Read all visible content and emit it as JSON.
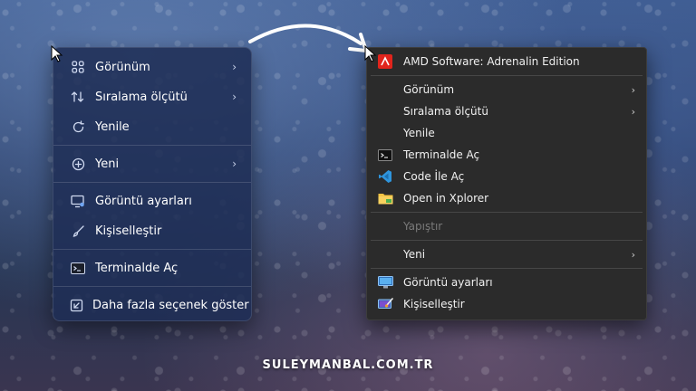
{
  "win11_menu": {
    "items": [
      {
        "label": "Görünüm",
        "icon": "grid-icon",
        "submenu": true
      },
      {
        "label": "Sıralama ölçütü",
        "icon": "sort-icon",
        "submenu": true
      },
      {
        "label": "Yenile",
        "icon": "refresh-icon",
        "submenu": false
      },
      {
        "label": "Yeni",
        "icon": "add-circle-icon",
        "submenu": true
      },
      {
        "label": "Görüntü ayarları",
        "icon": "display-settings-icon",
        "submenu": false
      },
      {
        "label": "Kişiselleştir",
        "icon": "brush-icon",
        "submenu": false
      },
      {
        "label": "Terminalde Aç",
        "icon": "terminal-icon",
        "submenu": false
      },
      {
        "label": "Daha fazla seçenek göster",
        "icon": "more-options-icon",
        "submenu": false
      }
    ]
  },
  "classic_menu": {
    "items": [
      {
        "label": "AMD Software: Adrenalin Edition",
        "icon": "amd-icon",
        "submenu": false,
        "disabled": false
      },
      {
        "label": "Görünüm",
        "icon": "",
        "submenu": true,
        "disabled": false
      },
      {
        "label": "Sıralama ölçütü",
        "icon": "",
        "submenu": true,
        "disabled": false
      },
      {
        "label": "Yenile",
        "icon": "",
        "submenu": false,
        "disabled": false
      },
      {
        "label": "Terminalde Aç",
        "icon": "terminal-icon",
        "submenu": false,
        "disabled": false
      },
      {
        "label": "Code İle Aç",
        "icon": "vscode-icon",
        "submenu": false,
        "disabled": false
      },
      {
        "label": "Open in Xplorer",
        "icon": "folder-icon",
        "submenu": false,
        "disabled": false
      },
      {
        "label": "Yapıştır",
        "icon": "",
        "submenu": false,
        "disabled": true
      },
      {
        "label": "Yeni",
        "icon": "",
        "submenu": true,
        "disabled": false
      },
      {
        "label": "Görüntü ayarları",
        "icon": "monitor-icon",
        "submenu": false,
        "disabled": false
      },
      {
        "label": "Kişiselleştir",
        "icon": "personalize-icon",
        "submenu": false,
        "disabled": false
      }
    ]
  },
  "watermark": "SULEYMANBAL.COM.TR",
  "colors": {
    "amd_red": "#e1241c",
    "vscode_blue": "#2f95dd",
    "folder_yellow": "#f3c343",
    "monitor_blue": "#5ab0f0"
  }
}
